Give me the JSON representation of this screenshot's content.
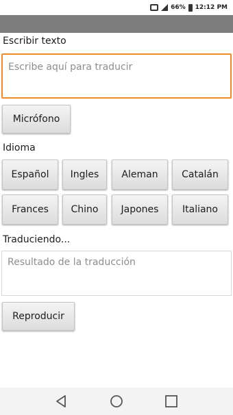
{
  "status_bar": {
    "battery_percent": "66%",
    "time": "12:12 PM"
  },
  "input_section": {
    "label": "Escribir texto",
    "placeholder": "Escribe aquí para traducir",
    "value": ""
  },
  "mic_button": {
    "label": "Micrófono"
  },
  "language_section": {
    "label": "Idioma",
    "languages": [
      "Español",
      "Ingles",
      "Aleman",
      "Catalán",
      "Frances",
      "Chino",
      "Japones",
      "Italiano"
    ]
  },
  "output_section": {
    "label": "Traduciendo...",
    "placeholder": "Resultado de la traducción"
  },
  "play_button": {
    "label": "Reproducir"
  },
  "nav": {
    "icons": [
      "back-icon",
      "home-icon",
      "recents-icon"
    ]
  },
  "colors": {
    "accent": "#f08a24",
    "action_bar": "#7d7d7d"
  }
}
